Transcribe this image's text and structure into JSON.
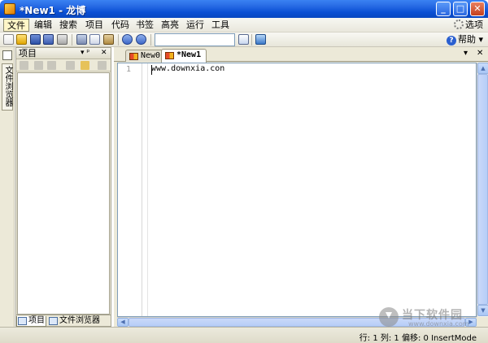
{
  "window": {
    "title": "*New1 - 龙博",
    "minimize": "_",
    "maximize": "□",
    "close": "✕"
  },
  "menu": {
    "items": [
      "文件",
      "编辑",
      "搜索",
      "项目",
      "代码",
      "书签",
      "高亮",
      "运行",
      "工具"
    ],
    "active": "文件",
    "options_label": "选项"
  },
  "toolbar": {
    "search_value": "",
    "help_label": "帮助",
    "help_arrow": "▾"
  },
  "side_strip": {
    "tab_label": "文件浏览器"
  },
  "project_panel": {
    "title": "项目",
    "pin_glyph": "▾ ᵖ",
    "close_glyph": "✕",
    "bottom_tabs": [
      "项目",
      "文件浏览器"
    ]
  },
  "editor": {
    "tabs": [
      "New0",
      "*New1"
    ],
    "active_tab": "*New1",
    "tab_menu_glyph": "▾",
    "tab_close_glyph": "✕",
    "line_numbers": [
      "1"
    ],
    "lines": [
      "www.downxia.con"
    ]
  },
  "status": {
    "text": "行: 1 列: 1 偏移: 0 InsertMode"
  },
  "watermark": {
    "title": "当下软件园",
    "url": "www.downxia.com"
  }
}
